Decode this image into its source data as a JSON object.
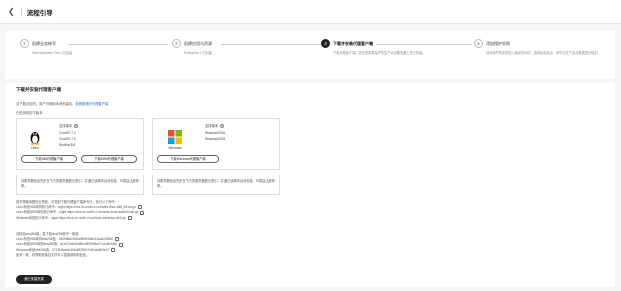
{
  "header": {
    "back_icon": "chevron-left-icon",
    "title": "流程引导"
  },
  "steps": [
    {
      "num": "1",
      "title": "创建业务帐号",
      "desc": "Site-replication Test-1已创建"
    },
    {
      "num": "2",
      "title": "创建应用与资源",
      "desc": "Enterprise-1 已创建"
    },
    {
      "num": "3",
      "title": "下载并安装代理客户端",
      "desc": "下载代理客户端，并在您需要保护的生产站点服务器上进行安装。"
    },
    {
      "num": "4",
      "title": "添加保护实例",
      "desc": "将待保护的实例加入保护实例中，选择目标站点，即可对生产站点数据进行保护。"
    }
  ],
  "main": {
    "title": "下载并安装代理客户端",
    "line1_prefix": "请下载对应的。用户可使用本地安装包，",
    "line1_link": "查看推荐的代理客户端",
    "line2": "已检测到如下版本:",
    "linux": {
      "name": "Linux",
      "support_label": "支持版本",
      "versions": [
        "CentOS 7.2",
        "CentOS 7.9",
        "RedHat 8.6"
      ],
      "btn_x86": "下载X86代理客户端",
      "btn_arm": "下载ARM代理客户端",
      "note": "将服务器信息同步至下方的服务器登记表中，并通过该脚本自动安装，可提高注册效率。"
    },
    "windows": {
      "name": "Windows",
      "support_label": "支持版本",
      "versions": [
        "Windows2016",
        "Windows2019"
      ],
      "btn": "下载Windows代理客户端",
      "note": "将服务器信息同步至下方的服务器登记表中，并通过该脚本自动安装，可提高注册效率。"
    },
    "cmd_intro": "若不想使用图形化界面，可复制下载代理客户端命令行，执行以下命令:",
    "cmds": [
      "Linux系统X86架构执行命令：wget https://ecs.cn-north-4.xxx/sdrs-linux-x86_64.tar.gz",
      "Linux系统ARM架构执行命令：wget https://ecs.cn-north-4.xxx/sdrs-linux-aarch64.tar.gz",
      "Windows系统执行命令：wget https://ecs.cn-north-4.xxx/sdrs-windows-x64.zip"
    ],
    "sha_intro": "请校验sha256值，若下载sha256值不一致则:",
    "shas": [
      "Linux系统X86架构sha256值：e5c9ff8d2a90aff4f8e3dbc11aa2c3f9d0",
      "Linux系统ARM架构sha256值：a1c97e4bd26f50c8f09e3bd7c11d8e5fa2",
      "Windows系统sha256值：3723f4bde8c1f6a89250c7cf41de8b9e12"
    ],
    "sha_note": "如有一致，则表明安装包文件可以直接使用到此处。",
    "primary_btn": "我已安装完成"
  }
}
